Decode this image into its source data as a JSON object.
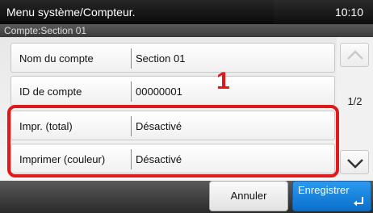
{
  "header": {
    "title": "Menu système/Compteur.",
    "time": "10:10",
    "subtitle": "Compte:Section 01"
  },
  "rows": [
    {
      "label": "Nom du compte",
      "value": "Section 01"
    },
    {
      "label": "ID de compte",
      "value": "00000001"
    },
    {
      "label": "Impr. (total)",
      "value": "Désactivé"
    },
    {
      "label": "Imprimer (couleur)",
      "value": "Désactivé"
    }
  ],
  "pager": {
    "page": "1/2"
  },
  "callout": "1",
  "footer": {
    "cancel_label": "Annuler",
    "save_label": "Enregistrer"
  },
  "colors": {
    "highlight": "#e0191b",
    "accent": "#1f87df"
  },
  "icons": {
    "up": "chevron-up-icon",
    "down": "chevron-down-icon",
    "enter": "enter-icon"
  }
}
